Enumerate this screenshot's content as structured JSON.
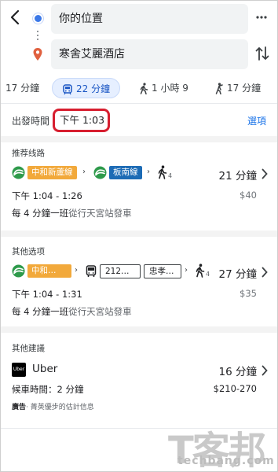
{
  "header": {
    "origin_value": "你的位置",
    "destination_value": "寒舍艾麗酒店"
  },
  "modes": [
    {
      "label": "17 分鐘",
      "icon": "car-icon",
      "selected": false
    },
    {
      "label": "22 分鐘",
      "icon": "transit-icon",
      "selected": true
    },
    {
      "label": "1 小時 9",
      "icon": "walk-icon",
      "selected": false
    },
    {
      "label": "17 分鐘",
      "icon": "rideshare-icon",
      "selected": false
    }
  ],
  "depart": {
    "label": "出發時間",
    "time": "下午 1:03",
    "options": "選項"
  },
  "recommended": {
    "title": "推荐线路",
    "lines": [
      {
        "name": "中和新蘆線",
        "color": "#f2a93b"
      },
      {
        "name": "板南線",
        "color": "#1c6bb5"
      }
    ],
    "walk_minutes": "4",
    "duration": "21 分鐘",
    "times": "下午 1:04 - 1:26",
    "price": "$40",
    "frequency": "每 4 分鐘一班",
    "from": "從行天宮站發車"
  },
  "other": {
    "title": "其他选项",
    "line": {
      "name": "中和…",
      "color": "#f2a93b"
    },
    "bus_route": "212…",
    "bus_route2": "忠孝…",
    "walk_minutes": "4",
    "duration": "27 分鐘",
    "times": "下午 1:04 - 1:31",
    "price": "$35",
    "frequency": "每 4 分鐘一班",
    "from": "從行天宮站發車"
  },
  "suggestions": {
    "title": "其他建議",
    "logo_text": "Uber",
    "name": "Uber",
    "duration": "16 分鐘",
    "wait": "候車時間：2 分鐘",
    "price": "$210-270",
    "ad_label": "廣告",
    "ad_text": "· 菁英優步的估計信息"
  },
  "watermark": {
    "big": "T客邦",
    "small": "techbang.com"
  },
  "colors": {
    "accent": "#1a73e8",
    "highlight_border": "#d71e2f",
    "metro_icon": "#2e9a4b"
  }
}
